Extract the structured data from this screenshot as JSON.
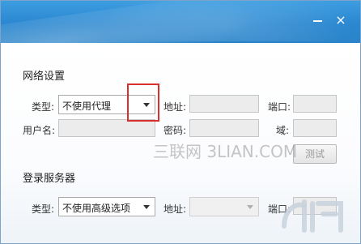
{
  "window": {
    "minimize_icon": "minimize-icon",
    "close_label": "×"
  },
  "network": {
    "section_title": "网络设置",
    "type_label": "类型:",
    "type_value": "不使用代理",
    "address_label": "地址:",
    "port_label": "端口:",
    "username_label": "用户名:",
    "password_label": "密码:",
    "domain_label": "域:",
    "test_button": "测试"
  },
  "login_server": {
    "section_title": "登录服务器",
    "type_label": "类型:",
    "type_value": "不使用高级选项",
    "address_label": "地址:",
    "port_label": "端口:"
  },
  "watermark": {
    "text": "三联网 3LIAN.COM"
  },
  "colors": {
    "titlebar": "#2a87d0",
    "highlight": "#d9302c"
  }
}
